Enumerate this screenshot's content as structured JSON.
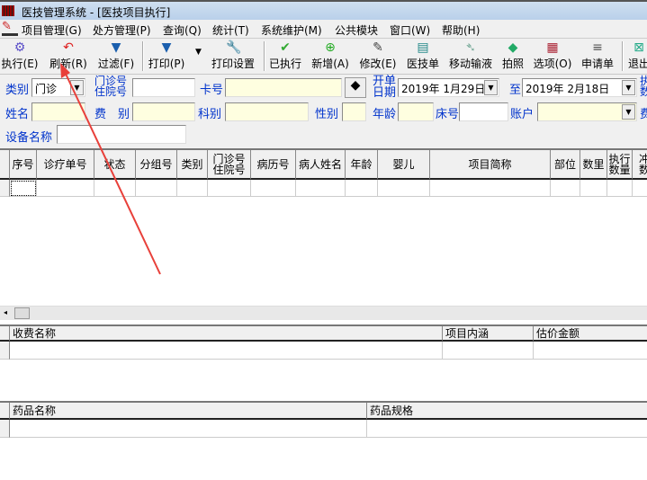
{
  "window": {
    "title": "医技管理系统 - [医技项目执行]"
  },
  "menu": [
    "项目管理(G)",
    "处方管理(P)",
    "查询(Q)",
    "统计(T)",
    "系统维护(M)",
    "公共模块",
    "窗口(W)",
    "帮助(H)"
  ],
  "toolbar": [
    {
      "label": "执行(E)",
      "icon": "gear-icon",
      "glyph": "⚙",
      "color": "#5b4fc9"
    },
    {
      "label": "刷新(R)",
      "icon": "refresh-icon",
      "glyph": "↶",
      "color": "#d22"
    },
    {
      "label": "过滤(F)",
      "icon": "filter-icon",
      "glyph": "▼",
      "color": "#1b5fae"
    },
    {
      "label": "打印(P)",
      "icon": "print-filter-icon",
      "glyph": "▼",
      "color": "#1b5fae"
    },
    {
      "label": "打印设置",
      "icon": "wrench-icon",
      "glyph": "🔧",
      "color": "#333"
    },
    {
      "label": "已执行",
      "icon": "check-icon",
      "glyph": "✔",
      "color": "#3a3"
    },
    {
      "label": "新增(A)",
      "icon": "add-icon",
      "glyph": "⊕",
      "color": "#2a2"
    },
    {
      "label": "修改(E)",
      "icon": "edit-icon",
      "glyph": "✎",
      "color": "#444"
    },
    {
      "label": "医技单",
      "icon": "clipboard-icon",
      "glyph": "▤",
      "color": "#288"
    },
    {
      "label": "移动输液",
      "icon": "infusion-icon",
      "glyph": "➴",
      "color": "#7a9"
    },
    {
      "label": "拍照",
      "icon": "camera-icon",
      "glyph": "◆",
      "color": "#2a6"
    },
    {
      "label": "选项(O)",
      "icon": "options-icon",
      "glyph": "▦",
      "color": "#a23"
    },
    {
      "label": "申请单",
      "icon": "form-icon",
      "glyph": "≡",
      "color": "#555"
    },
    {
      "label": "退出",
      "icon": "exit-icon",
      "glyph": "⊠",
      "color": "#2a8"
    }
  ],
  "filters": {
    "category_label": "类别",
    "category_value": "门诊",
    "outpatient_label_1": "门诊号",
    "outpatient_label_2": "住院号",
    "outpatient_value": "",
    "card_label": "卡号",
    "card_value": "",
    "date_label_1": "开单",
    "date_label_2": "日期",
    "date_from": "2019年 1月29日",
    "to_label": "至",
    "date_to": "2019年 2月18日",
    "exec_label_1": "执",
    "exec_label_2": "数",
    "name_label": "姓名",
    "fee_label": "费　别",
    "dept_label": "科别",
    "gender_label": "性别",
    "age_label": "年龄",
    "bed_label": "床号",
    "account_label": "账户",
    "fee2_label": "费",
    "device_label": "设备名称"
  },
  "grid_main": {
    "columns": [
      "序号",
      "诊疗单号",
      "状态",
      "分组号",
      "类别",
      "门诊号\n住院号",
      "病历号",
      "病人姓名",
      "年龄",
      "婴儿",
      "项目简称",
      "部位",
      "数里",
      "执行\n数量",
      "冲\n数"
    ]
  },
  "grid_fee": {
    "columns": [
      "收费名称",
      "项目内涵",
      "估价金额"
    ]
  },
  "grid_drug": {
    "columns": [
      "药品名称",
      "药品规格"
    ]
  },
  "annotation_color": "#e8403a"
}
